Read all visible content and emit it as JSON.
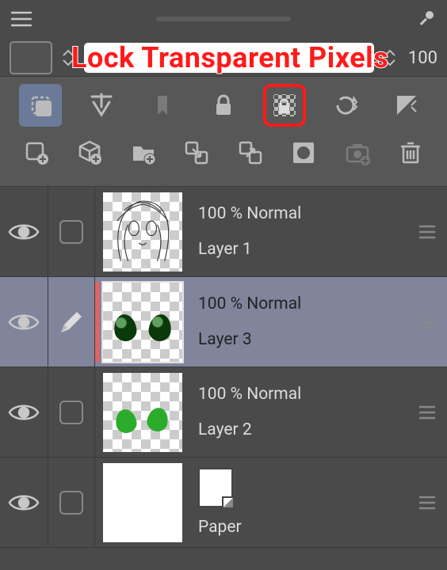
{
  "callout": "Lock Transparent Pixels",
  "options": {
    "opacity": "100"
  },
  "toolbar_row1": [
    {
      "id": "select-layer-icon",
      "sel": true
    },
    {
      "id": "anchor-icon"
    },
    {
      "id": "bookmark-icon",
      "disabled": true
    },
    {
      "id": "lock-icon"
    },
    {
      "id": "lock-transparent-pixels-icon",
      "highlight": true
    },
    {
      "id": "reload-icon"
    },
    {
      "id": "triangle-close-icon"
    }
  ],
  "toolbar_row2": [
    {
      "id": "new-layer-icon"
    },
    {
      "id": "new-3d-layer-icon"
    },
    {
      "id": "new-folder-icon"
    },
    {
      "id": "transfer-down-icon"
    },
    {
      "id": "duplicate-icon"
    },
    {
      "id": "mask-icon"
    },
    {
      "id": "camera-icon",
      "disabled": true
    },
    {
      "id": "trash-icon"
    }
  ],
  "layers": [
    {
      "opacity": "100 %",
      "blend": "Normal",
      "name": "Layer 1",
      "type": "sketch",
      "selected": false,
      "editing": false
    },
    {
      "opacity": "100 %",
      "blend": "Normal",
      "name": "Layer 3",
      "type": "eyes-dark",
      "selected": true,
      "editing": true
    },
    {
      "opacity": "100 %",
      "blend": "Normal",
      "name": "Layer 2",
      "type": "eyes-green",
      "selected": false,
      "editing": false
    },
    {
      "opacity": "",
      "blend": "",
      "name": "Paper",
      "type": "paper",
      "selected": false,
      "editing": false
    }
  ]
}
